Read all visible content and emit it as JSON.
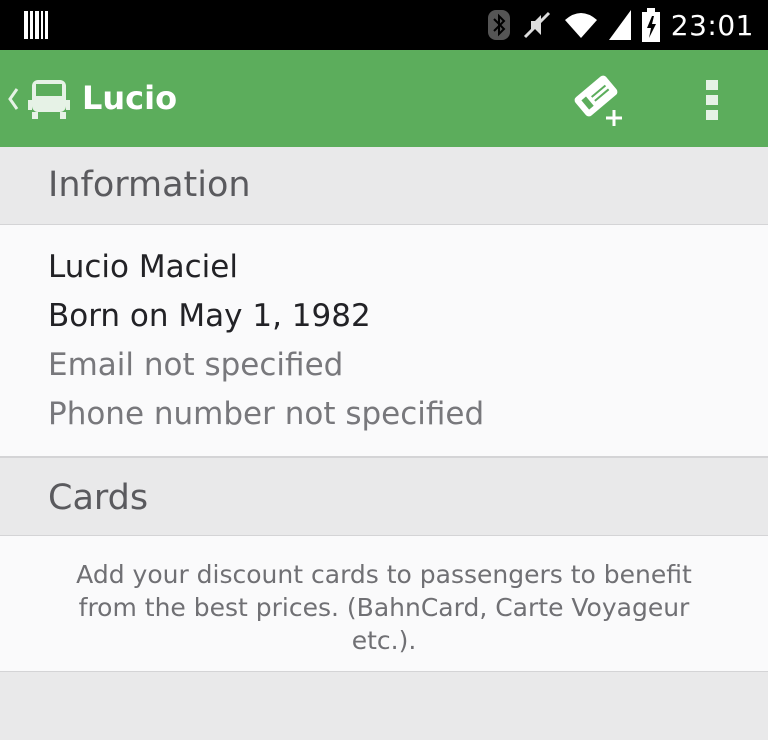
{
  "status_bar": {
    "time": "23:01",
    "icons": [
      "barcode-icon",
      "bluetooth-icon",
      "mute-icon",
      "wifi-icon",
      "signal-icon",
      "battery-charging-icon"
    ]
  },
  "action_bar": {
    "title": "Lucio",
    "app_icon": "train-icon",
    "actions": [
      "add-card-icon",
      "overflow-menu-icon"
    ]
  },
  "sections": {
    "information": {
      "header": "Information",
      "name": "Lucio Maciel",
      "birth": "Born on May 1, 1982",
      "email": "Email not specified",
      "phone": "Phone number not specified"
    },
    "cards": {
      "header": "Cards",
      "hint": "Add your discount cards to passengers to benefit from the best prices. (BahnCard, Carte Voyageur etc.)."
    }
  },
  "colors": {
    "action_bar": "#5cad5c",
    "status_bar": "#000000",
    "section_bg": "#e9e9ea",
    "content_bg": "#fafafb"
  }
}
